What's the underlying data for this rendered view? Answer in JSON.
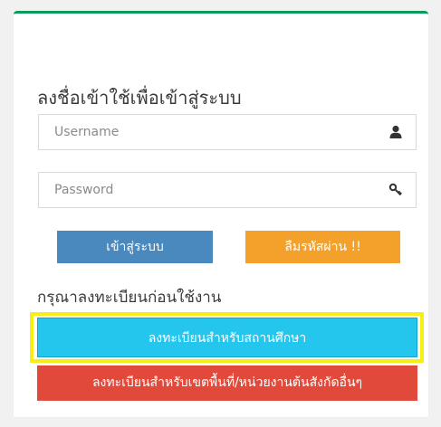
{
  "login": {
    "heading": "ลงชื่อเข้าใช้เพื่อเข้าสู่ระบบ",
    "username_placeholder": "Username",
    "password_placeholder": "Password",
    "username_icon": "user-icon",
    "password_icon": "key-icon",
    "login_button": "เข้าสู่ระบบ",
    "forgot_button": "ลืมรหัสผ่าน !!"
  },
  "register": {
    "heading": "กรุณาลงทะเบียนก่อนใช้งาน",
    "school_button": "ลงทะเบียนสำหรับสถานศึกษา",
    "area_button": "ลงทะเบียนสำหรับเขตพื้นที่/หน่วยงานต้นสังกัดอื่นๆ"
  },
  "colors": {
    "panel_top_border": "#0a9a5a",
    "login_button": "#4a89bd",
    "forgot_button": "#f4a12b",
    "school_button": "#25c6ee",
    "area_button": "#e14a3a",
    "highlight_outline": "#f7ef14"
  }
}
